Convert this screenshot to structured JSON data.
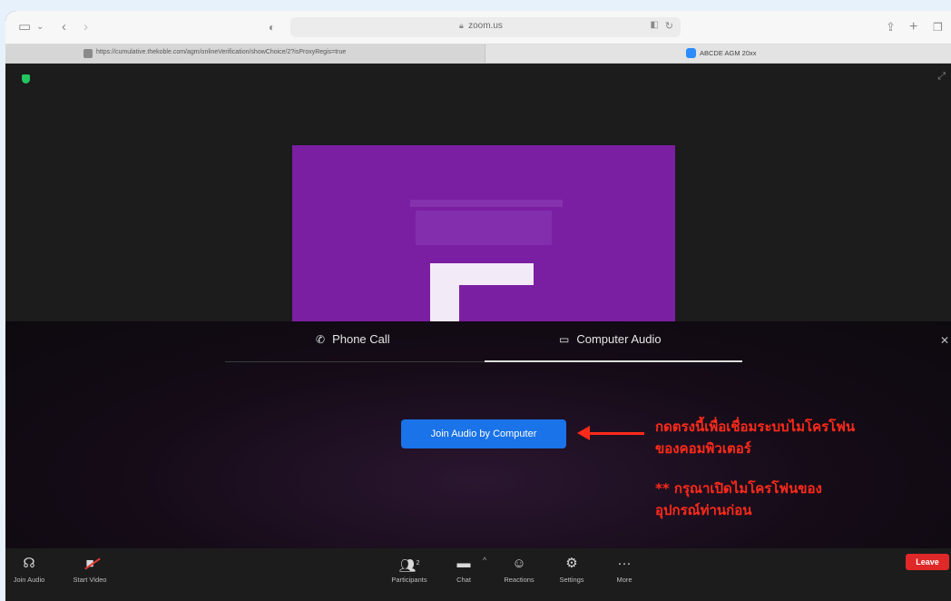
{
  "browser": {
    "address": "zoom.us",
    "tabs": [
      {
        "label": "https://cumulative.thekoble.com/agm/onlineVerification/showChoice/2?isProxyRegis=true"
      },
      {
        "label": "ABCDE AGM 20xx"
      }
    ]
  },
  "audio_panel": {
    "tabs": [
      {
        "label": "Phone Call",
        "icon": "phone-icon"
      },
      {
        "label": "Computer Audio",
        "icon": "monitor-icon"
      }
    ],
    "active_tab": "Computer Audio",
    "join_button": "Join Audio by Computer"
  },
  "annotation": {
    "color": "#ff2a1a",
    "line1": "กดตรงนี้เพื่อเชื่อมระบบไมโครโฟน",
    "line2": "ของคอมพิวเตอร์",
    "line3": "** กรุณาเปิดไมโครโฟนของ",
    "line4": "อุปกรณ์ท่านก่อน"
  },
  "controls": {
    "join_audio": "Join Audio",
    "start_video": "Start Video",
    "participants": "Participants",
    "participants_count": "2",
    "chat": "Chat",
    "reactions": "Reactions",
    "settings": "Settings",
    "more": "More",
    "leave": "Leave"
  }
}
